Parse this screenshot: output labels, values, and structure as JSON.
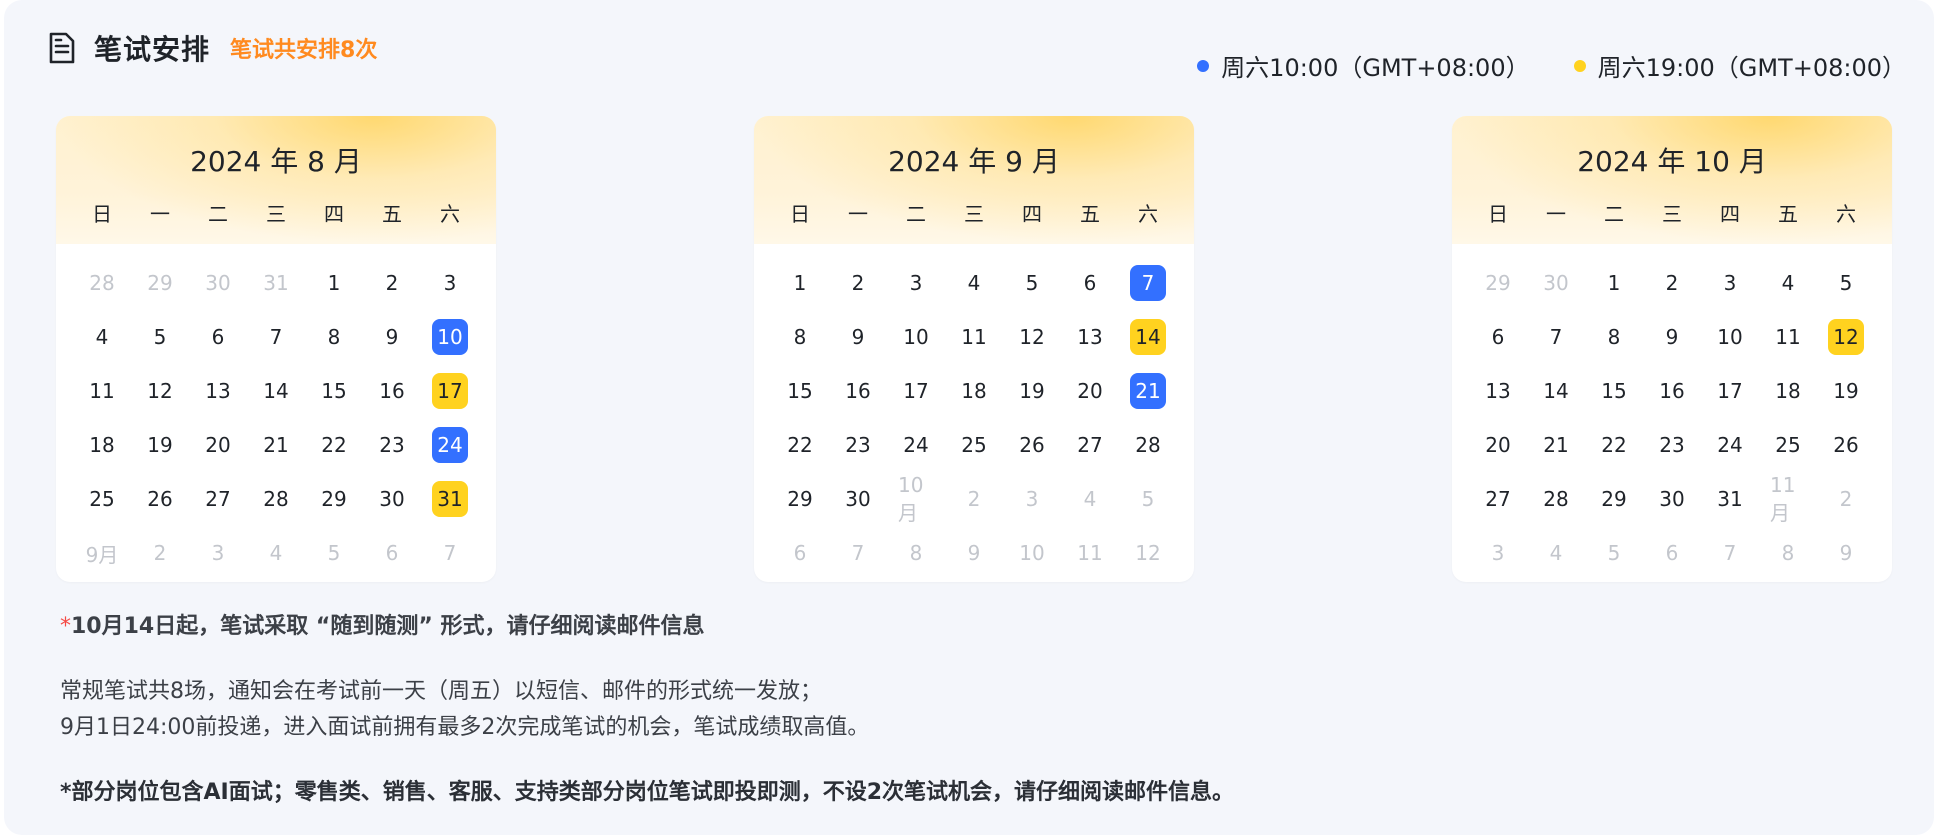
{
  "header": {
    "title": "笔试安排",
    "subtitle": "笔试共安排8次",
    "icon": "document-icon"
  },
  "legend": [
    {
      "label": "周六10:00（GMT+08:00）",
      "color": "#3370ff"
    },
    {
      "label": "周六19:00（GMT+08:00）",
      "color": "#ffd21f"
    }
  ],
  "weekdays": [
    "日",
    "一",
    "二",
    "三",
    "四",
    "五",
    "六"
  ],
  "calendars": [
    {
      "title": "2024 年 8 月",
      "days": [
        {
          "t": "28",
          "s": "muted"
        },
        {
          "t": "29",
          "s": "muted"
        },
        {
          "t": "30",
          "s": "muted"
        },
        {
          "t": "31",
          "s": "muted"
        },
        {
          "t": "1"
        },
        {
          "t": "2"
        },
        {
          "t": "3"
        },
        {
          "t": "4"
        },
        {
          "t": "5"
        },
        {
          "t": "6"
        },
        {
          "t": "7"
        },
        {
          "t": "8"
        },
        {
          "t": "9"
        },
        {
          "t": "10",
          "s": "blue"
        },
        {
          "t": "11"
        },
        {
          "t": "12"
        },
        {
          "t": "13"
        },
        {
          "t": "14"
        },
        {
          "t": "15"
        },
        {
          "t": "16"
        },
        {
          "t": "17",
          "s": "yellow"
        },
        {
          "t": "18"
        },
        {
          "t": "19"
        },
        {
          "t": "20"
        },
        {
          "t": "21"
        },
        {
          "t": "22"
        },
        {
          "t": "23"
        },
        {
          "t": "24",
          "s": "blue"
        },
        {
          "t": "25"
        },
        {
          "t": "26"
        },
        {
          "t": "27"
        },
        {
          "t": "28"
        },
        {
          "t": "29"
        },
        {
          "t": "30"
        },
        {
          "t": "31",
          "s": "yellow"
        },
        {
          "t": "9月",
          "s": "muted"
        },
        {
          "t": "2",
          "s": "muted"
        },
        {
          "t": "3",
          "s": "muted"
        },
        {
          "t": "4",
          "s": "muted"
        },
        {
          "t": "5",
          "s": "muted"
        },
        {
          "t": "6",
          "s": "muted"
        },
        {
          "t": "7",
          "s": "muted"
        }
      ]
    },
    {
      "title": "2024 年 9 月",
      "days": [
        {
          "t": "1"
        },
        {
          "t": "2"
        },
        {
          "t": "3"
        },
        {
          "t": "4"
        },
        {
          "t": "5"
        },
        {
          "t": "6"
        },
        {
          "t": "7",
          "s": "blue"
        },
        {
          "t": "8"
        },
        {
          "t": "9"
        },
        {
          "t": "10"
        },
        {
          "t": "11"
        },
        {
          "t": "12"
        },
        {
          "t": "13"
        },
        {
          "t": "14",
          "s": "yellow"
        },
        {
          "t": "15"
        },
        {
          "t": "16"
        },
        {
          "t": "17"
        },
        {
          "t": "18"
        },
        {
          "t": "19"
        },
        {
          "t": "20"
        },
        {
          "t": "21",
          "s": "blue"
        },
        {
          "t": "22"
        },
        {
          "t": "23"
        },
        {
          "t": "24"
        },
        {
          "t": "25"
        },
        {
          "t": "26"
        },
        {
          "t": "27"
        },
        {
          "t": "28"
        },
        {
          "t": "29"
        },
        {
          "t": "30"
        },
        {
          "t": "10月",
          "s": "muted"
        },
        {
          "t": "2",
          "s": "muted"
        },
        {
          "t": "3",
          "s": "muted"
        },
        {
          "t": "4",
          "s": "muted"
        },
        {
          "t": "5",
          "s": "muted"
        },
        {
          "t": "6",
          "s": "muted"
        },
        {
          "t": "7",
          "s": "muted"
        },
        {
          "t": "8",
          "s": "muted"
        },
        {
          "t": "9",
          "s": "muted"
        },
        {
          "t": "10",
          "s": "muted"
        },
        {
          "t": "11",
          "s": "muted"
        },
        {
          "t": "12",
          "s": "muted"
        }
      ]
    },
    {
      "title": "2024 年 10 月",
      "days": [
        {
          "t": "29",
          "s": "muted"
        },
        {
          "t": "30",
          "s": "muted"
        },
        {
          "t": "1"
        },
        {
          "t": "2"
        },
        {
          "t": "3"
        },
        {
          "t": "4"
        },
        {
          "t": "5"
        },
        {
          "t": "6"
        },
        {
          "t": "7"
        },
        {
          "t": "8"
        },
        {
          "t": "9"
        },
        {
          "t": "10"
        },
        {
          "t": "11"
        },
        {
          "t": "12",
          "s": "yellow"
        },
        {
          "t": "13"
        },
        {
          "t": "14"
        },
        {
          "t": "15"
        },
        {
          "t": "16"
        },
        {
          "t": "17"
        },
        {
          "t": "18"
        },
        {
          "t": "19"
        },
        {
          "t": "20"
        },
        {
          "t": "21"
        },
        {
          "t": "22"
        },
        {
          "t": "23"
        },
        {
          "t": "24"
        },
        {
          "t": "25"
        },
        {
          "t": "26"
        },
        {
          "t": "27"
        },
        {
          "t": "28"
        },
        {
          "t": "29"
        },
        {
          "t": "30"
        },
        {
          "t": "31"
        },
        {
          "t": "11月",
          "s": "muted"
        },
        {
          "t": "2",
          "s": "muted"
        },
        {
          "t": "3",
          "s": "muted"
        },
        {
          "t": "4",
          "s": "muted"
        },
        {
          "t": "5",
          "s": "muted"
        },
        {
          "t": "6",
          "s": "muted"
        },
        {
          "t": "7",
          "s": "muted"
        },
        {
          "t": "8",
          "s": "muted"
        },
        {
          "t": "9",
          "s": "muted"
        }
      ]
    }
  ],
  "notes": {
    "star": "*",
    "note1": "10月14日起，笔试采取 “随到随测” 形式，请仔细阅读邮件信息",
    "desc_line1": "常规笔试共8场，通知会在考试前一天（周五）以短信、邮件的形式统一发放；",
    "desc_line2": "9月1日24:00前投递，进入面试前拥有最多2次完成笔试的机会，笔试成绩取高值。",
    "note2": "*部分岗位包含AI面试；零售类、销售、客服、支持类部分岗位笔试即投即测，不设2次笔试机会，请仔细阅读邮件信息。"
  }
}
